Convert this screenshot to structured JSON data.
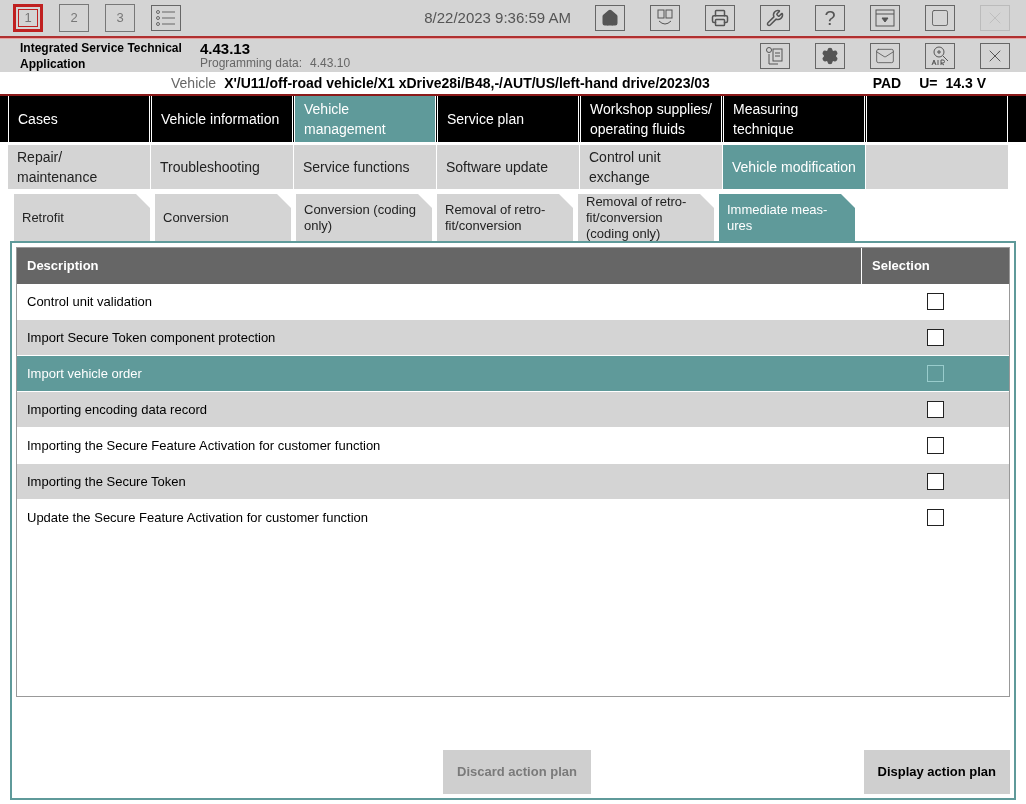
{
  "top_bar": {
    "session_tabs": [
      {
        "label": "1",
        "selected": true
      },
      {
        "label": "2",
        "selected": false
      },
      {
        "label": "3",
        "selected": false
      }
    ],
    "datetime": "8/22/2023 9:36:59 AM",
    "help_label": "?"
  },
  "header": {
    "app_name": "Integrated Service Technical Application",
    "version": "4.43.13",
    "programming_label": "Programming data:",
    "programming_version": "4.43.10"
  },
  "vehicle_bar": {
    "label": "Vehicle",
    "value": "X'/U11/off-road vehicle/X1 xDrive28i/B48,-/AUT/US/left-hand drive/2023/03",
    "interface": "PAD",
    "voltage_label": "U=",
    "voltage": "14.3 V"
  },
  "main_menu": [
    {
      "label": "Cases",
      "selected": false
    },
    {
      "label": "Vehicle information",
      "selected": false
    },
    {
      "label": "Vehicle management",
      "selected": true
    },
    {
      "label": "Service plan",
      "selected": false
    },
    {
      "label": "Workshop supplies/ operating fluids",
      "selected": false
    },
    {
      "label": "Measuring technique",
      "selected": false
    }
  ],
  "sub_menu": [
    {
      "label": "Repair/ maintenance",
      "selected": false
    },
    {
      "label": "Troubleshooting",
      "selected": false
    },
    {
      "label": "Service functions",
      "selected": false
    },
    {
      "label": "Software update",
      "selected": false
    },
    {
      "label": "Control unit exchange",
      "selected": false
    },
    {
      "label": "Vehicle modification",
      "selected": true
    }
  ],
  "tabs": [
    {
      "label": "Retrofit",
      "selected": false
    },
    {
      "label": "Conversion",
      "selected": false
    },
    {
      "label": "Conversion (coding only)",
      "selected": false
    },
    {
      "label": "Removal of retro-fit/conversion",
      "selected": false
    },
    {
      "label": "Removal of retro-fit/conversion (coding only)",
      "selected": false
    },
    {
      "label": "Immediate meas-ures",
      "selected": true
    }
  ],
  "table": {
    "columns": [
      "Description",
      "Selection"
    ],
    "rows": [
      {
        "description": "Control unit validation",
        "checked": false,
        "selected": false
      },
      {
        "description": "Import Secure Token component protection",
        "checked": false,
        "selected": false
      },
      {
        "description": "Import vehicle order",
        "checked": false,
        "selected": true
      },
      {
        "description": "Importing encoding data record",
        "checked": false,
        "selected": false
      },
      {
        "description": "Importing the Secure Feature Activation for customer function",
        "checked": false,
        "selected": false
      },
      {
        "description": "Importing the Secure Token",
        "checked": false,
        "selected": false
      },
      {
        "description": "Update the Secure Feature Activation for customer function",
        "checked": false,
        "selected": false
      }
    ]
  },
  "buttons": [
    {
      "label": "Discard action plan",
      "disabled": true
    },
    {
      "label": "Display action plan",
      "disabled": false
    }
  ]
}
